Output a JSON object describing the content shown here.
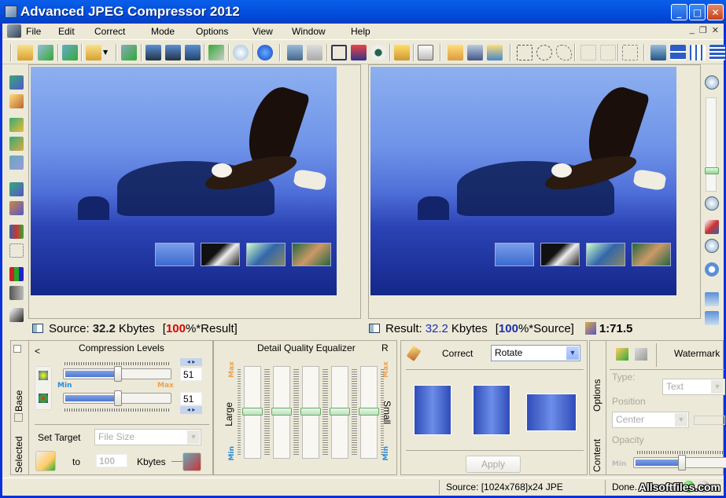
{
  "window": {
    "title": "Advanced JPEG Compressor 2012",
    "controls": {
      "minimize": "_",
      "maximize": "□",
      "close": "✕"
    }
  },
  "menubar": {
    "items": [
      "File",
      "Edit",
      "Correct",
      "Mode",
      "Options",
      "View",
      "Window",
      "Help"
    ],
    "mdi_controls": [
      "_",
      "❐",
      "✕"
    ]
  },
  "toolbar": {
    "icons": [
      "open-icon",
      "batch-open-icon",
      "convert-icon",
      "open-folder-icon",
      "dropdown-arrow-icon",
      "batch-convert-icon",
      "save-icon",
      "save-as-icon",
      "save-web-icon",
      "export-mail-icon",
      "info-icon",
      "help-icon",
      "tile-windows-icon",
      "cascade-icon",
      "crop-icon",
      "resize-icon",
      "preview-eye-icon",
      "edit-note-icon",
      "properties-icon",
      "hand-pan-icon",
      "select-zoom-icon",
      "hand-pan-alt-icon",
      "rect-select-icon",
      "ellipse-select-icon",
      "lasso-select-icon",
      "cut-selection-icon",
      "clear-selection-icon",
      "selection-zoom-icon",
      "window-layout-icon",
      "horizontal-split-icon",
      "vertical-split-icon",
      "list-layout-icon"
    ]
  },
  "left_toolbar": {
    "icons": [
      "compress-icon",
      "magic-wand-icon",
      "compress-selected-icon",
      "compress-lock-icon",
      "compress-dim-icon",
      "compress-region-icon",
      "compress-dotted-icon",
      "channels-icon",
      "channels-dotted-icon",
      "rgb-icon",
      "grayscale-icon",
      "levels-icon"
    ]
  },
  "right_toolbar": {
    "zoom_in": "zoom-in-icon",
    "zoom_out": "zoom-out-icon",
    "zoom_level_fraction": 0.25,
    "icons": [
      "fit-window-icon",
      "actual-size-icon",
      "navigator-icon",
      "layout-side-icon",
      "layout-stacked-icon"
    ]
  },
  "source_view": {
    "label": "Source:",
    "size_value": "32.2",
    "size_unit": "Kbytes",
    "bracket_open": "[",
    "percent": "100",
    "percent_suffix": "%*Result]"
  },
  "result_view": {
    "label": "Result:",
    "size_value": "32.2",
    "size_unit": "Kbytes",
    "bracket_open": "[",
    "percent": "100",
    "percent_suffix": "%*Source]",
    "ratio": "1:71.5"
  },
  "compression_panel": {
    "collapse": "<",
    "title": "Compression Levels",
    "slider1_value": "51",
    "slider2_value": "51",
    "slider1_fraction": 0.51,
    "slider2_fraction": 0.51,
    "min_label": "Min",
    "max_label": "Max",
    "spin": "◂ ▸",
    "set_target_label": "Set Target",
    "target_type": "File Size",
    "to_label": "to",
    "target_value": "100",
    "target_unit": "Kbytes",
    "tabs": [
      "Base",
      "Selected"
    ]
  },
  "equalizer_panel": {
    "title": "Detail Quality Equalizer",
    "r_label": "R",
    "large_label": "Large",
    "large_arrow": "<",
    "small_label": "Small",
    "max_label": "Max",
    "min_label": "Min",
    "band_fractions": [
      0.5,
      0.5,
      0.5,
      0.5,
      0.5
    ]
  },
  "correct_panel": {
    "label": "Correct",
    "mode": "Rotate",
    "rotations": [
      "rotate-90-ccw",
      "rotate-90-cw",
      "flip-vertical"
    ],
    "apply_label": "Apply"
  },
  "watermark_panel": {
    "title": "Watermark",
    "tabs": [
      "Options",
      "Content"
    ],
    "type_label": "Type:",
    "type_value": "Text",
    "position_label": "Position",
    "position_value": "Center",
    "opacity_label": "Opacity",
    "opacity_min": "Min",
    "opacity_fraction": 0.45
  },
  "statusbar": {
    "source_info": "Source: [1024x768]x24 JPE",
    "status": "Done.",
    "watermark_text": "Allsoftfiles.com"
  },
  "colors": {
    "titlebar": "#0553e0",
    "source_percent": "#e00000",
    "result_value": "#1a2fb0",
    "min_label": "#2a8ad8",
    "max_label": "#f0a050"
  }
}
